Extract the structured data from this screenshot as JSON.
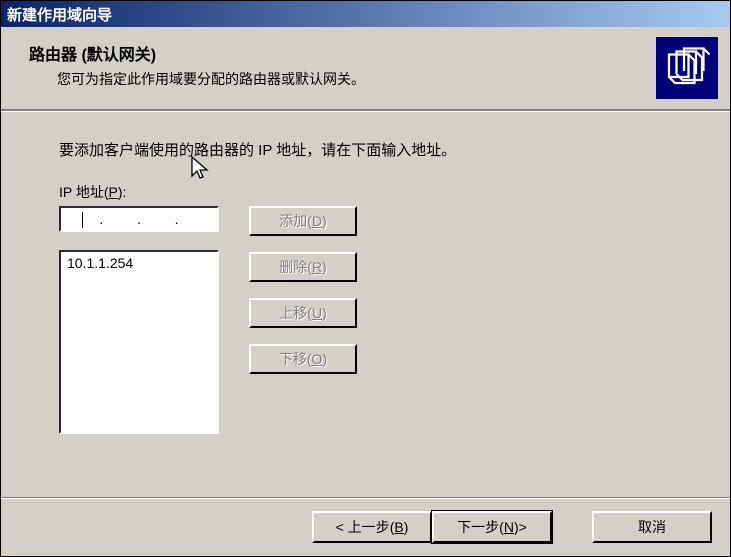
{
  "window": {
    "title": "新建作用域向导"
  },
  "header": {
    "title": "路由器 (默认网关)",
    "subtitle": "您可为指定此作用域要分配的路由器或默认网关。"
  },
  "content": {
    "instruction": "要添加客户端使用的路由器的 IP 地址，请在下面输入地址。",
    "ip_label": "IP 地址",
    "ip_mnemonic": "P",
    "ip_value": "",
    "list_items": [
      "10.1.1.254"
    ]
  },
  "buttons": {
    "add": "添加",
    "add_mn": "D",
    "remove": "删除",
    "remove_mn": "R",
    "up": "上移",
    "up_mn": "U",
    "down": "下移",
    "down_mn": "O"
  },
  "footer": {
    "back": "< 上一步",
    "back_mn": "B",
    "next": "下一步",
    "next_mn": "N",
    "next_suffix": " >",
    "cancel": "取消"
  }
}
